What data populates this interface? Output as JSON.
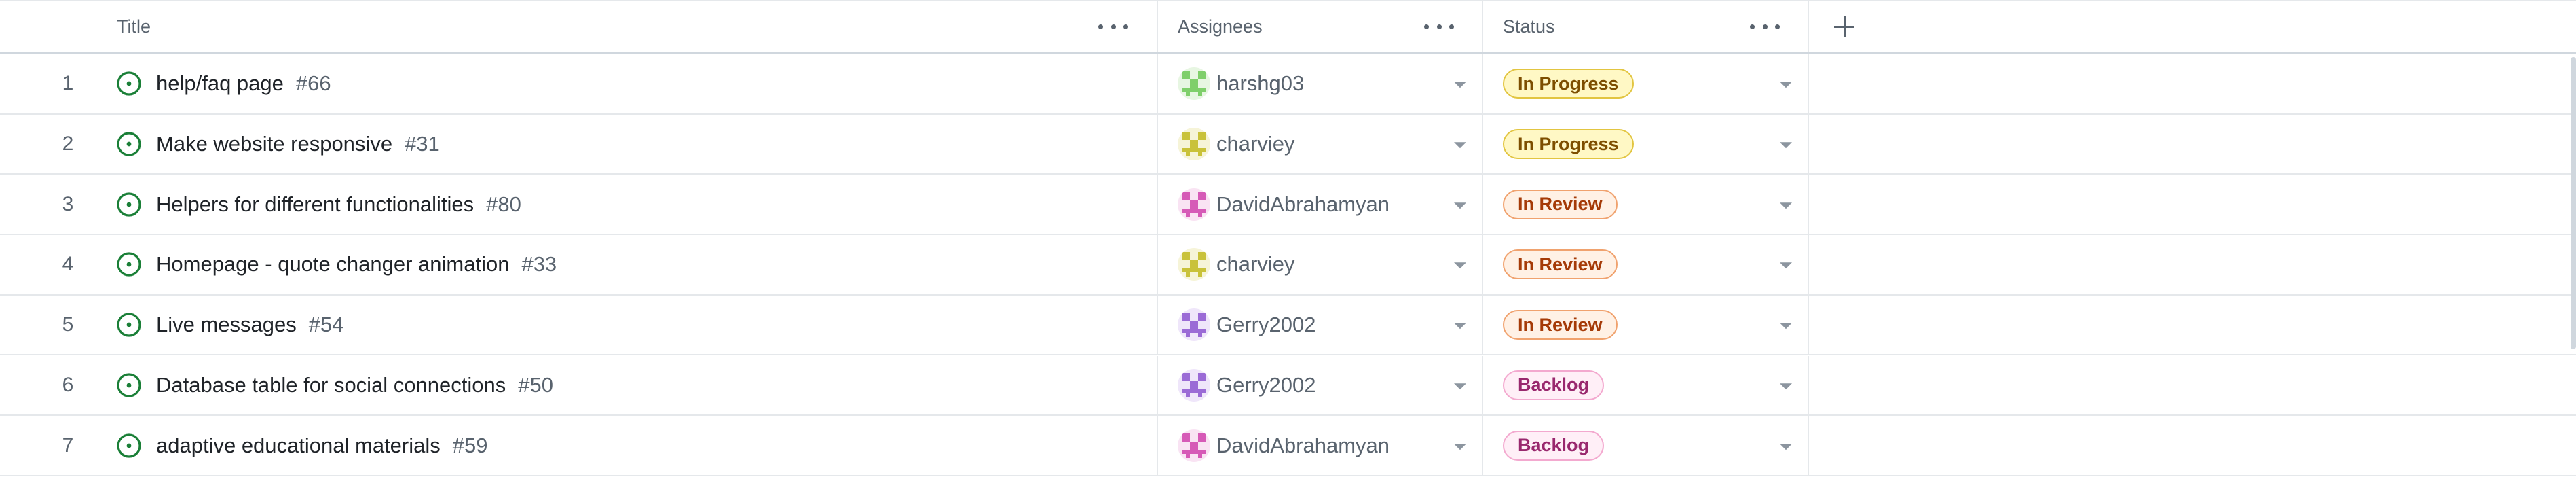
{
  "header": {
    "title_col": "Title",
    "assignees_col": "Assignees",
    "status_col": "Status"
  },
  "icons": {
    "issue_open": "issue-opened-icon",
    "column_options": "kebab-horizontal-icon",
    "add_field": "plus-icon",
    "dropdown": "triangle-down-icon"
  },
  "colors": {
    "issue_open": "#1a7f37",
    "in_progress_bg": "#fff8c5",
    "in_progress_border": "#e2c541",
    "in_progress_text": "#7d4e00",
    "in_review_bg": "#fff1e5",
    "in_review_border": "#f0a26e",
    "in_review_text": "#a53a07",
    "backlog_bg": "#ffeff7",
    "backlog_border": "#f3a9cf",
    "backlog_text": "#99286e"
  },
  "rows": [
    {
      "num": "1",
      "title": "help/faq page",
      "issue": "#66",
      "assignee": "harshg03",
      "avatar": "green",
      "status": "In Progress",
      "status_kind": "in_progress"
    },
    {
      "num": "2",
      "title": "Make website responsive",
      "issue": "#31",
      "assignee": "charviey",
      "avatar": "olive",
      "status": "In Progress",
      "status_kind": "in_progress"
    },
    {
      "num": "3",
      "title": "Helpers for different functionalities",
      "issue": "#80",
      "assignee": "DavidAbrahamyan",
      "avatar": "pink",
      "status": "In Review",
      "status_kind": "in_review"
    },
    {
      "num": "4",
      "title": "Homepage - quote changer animation",
      "issue": "#33",
      "assignee": "charviey",
      "avatar": "olive",
      "status": "In Review",
      "status_kind": "in_review"
    },
    {
      "num": "5",
      "title": "Live messages",
      "issue": "#54",
      "assignee": "Gerry2002",
      "avatar": "purple",
      "status": "In Review",
      "status_kind": "in_review"
    },
    {
      "num": "6",
      "title": "Database table for social connections",
      "issue": "#50",
      "assignee": "Gerry2002",
      "avatar": "purple",
      "status": "Backlog",
      "status_kind": "backlog"
    },
    {
      "num": "7",
      "title": "adaptive educational materials",
      "issue": "#59",
      "assignee": "DavidAbrahamyan",
      "avatar": "pink",
      "status": "Backlog",
      "status_kind": "backlog"
    }
  ]
}
